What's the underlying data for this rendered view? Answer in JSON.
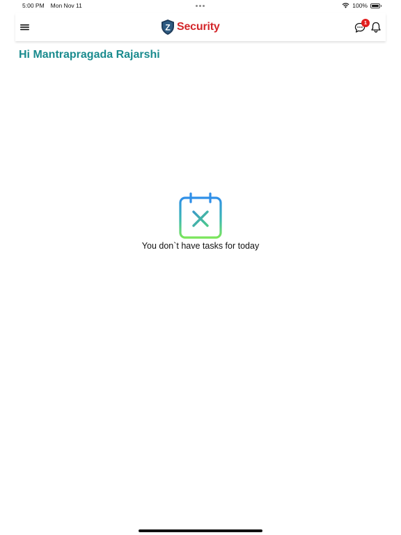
{
  "status_bar": {
    "time": "5:00 PM",
    "date": "Mon Nov 11",
    "battery_text": "100%",
    "battery_level": 1.0,
    "icons": [
      "wifi-icon",
      "battery-icon"
    ]
  },
  "header": {
    "brand_letter": "Z",
    "brand_name": "Security",
    "brand_color": "#d3262a",
    "chat_badge_count": "1",
    "icons": [
      "menu-icon",
      "shield-logo-icon",
      "chat-icon",
      "bell-icon"
    ]
  },
  "greeting": {
    "text": "Hi Mantrapragada Rajarshi",
    "color": "#1a8b8e"
  },
  "empty_state": {
    "icon": "calendar-x-icon",
    "message": "You don`t have tasks for today"
  }
}
